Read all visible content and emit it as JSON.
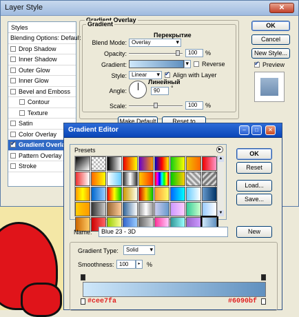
{
  "layer_style": {
    "title": "Layer Style",
    "styles_list": {
      "header": "Styles",
      "items": [
        {
          "label": "Blending Options: Default",
          "checkbox": false,
          "checked": false,
          "indent": false,
          "selected": false
        },
        {
          "label": "Drop Shadow",
          "checkbox": true,
          "checked": false,
          "indent": false,
          "selected": false
        },
        {
          "label": "Inner Shadow",
          "checkbox": true,
          "checked": false,
          "indent": false,
          "selected": false
        },
        {
          "label": "Outer Glow",
          "checkbox": true,
          "checked": false,
          "indent": false,
          "selected": false
        },
        {
          "label": "Inner Glow",
          "checkbox": true,
          "checked": false,
          "indent": false,
          "selected": false
        },
        {
          "label": "Bevel and Emboss",
          "checkbox": true,
          "checked": false,
          "indent": false,
          "selected": false
        },
        {
          "label": "Contour",
          "checkbox": true,
          "checked": false,
          "indent": true,
          "selected": false
        },
        {
          "label": "Texture",
          "checkbox": true,
          "checked": false,
          "indent": true,
          "selected": false
        },
        {
          "label": "Satin",
          "checkbox": true,
          "checked": false,
          "indent": false,
          "selected": false
        },
        {
          "label": "Color Overlay",
          "checkbox": true,
          "checked": false,
          "indent": false,
          "selected": false
        },
        {
          "label": "Gradient Overlay",
          "checkbox": true,
          "checked": true,
          "indent": false,
          "selected": true
        },
        {
          "label": "Pattern Overlay",
          "checkbox": true,
          "checked": false,
          "indent": false,
          "selected": false
        },
        {
          "label": "Stroke",
          "checkbox": true,
          "checked": false,
          "indent": false,
          "selected": false
        }
      ]
    },
    "section_title": "Gradient Overlay",
    "subsection_title": "Gradient",
    "blend_mode_label": "Blend Mode:",
    "blend_mode_value": "Overlay",
    "opacity_label": "Opacity:",
    "opacity_value": "100",
    "gradient_label": "Gradient:",
    "reverse_label": "Reverse",
    "style_label": "Style:",
    "style_value": "Linear",
    "align_label": "Align with Layer",
    "angle_label": "Angle:",
    "angle_value": "90",
    "angle_unit": "°",
    "scale_label": "Scale:",
    "scale_value": "100",
    "percent": "%",
    "make_default": "Make Default",
    "reset_default": "Reset to Default",
    "ok": "OK",
    "cancel": "Cancel",
    "new_style": "New Style...",
    "preview_label": "Preview",
    "annotation_blend": "Перекрытие",
    "annotation_style": "Линейный",
    "opacity_level": 0.95,
    "scale_level": 0.5
  },
  "gradient_editor": {
    "title": "Gradient Editor",
    "presets_label": "Presets",
    "ok": "OK",
    "reset": "Reset",
    "load": "Load...",
    "save": "Save...",
    "name_label": "Name:",
    "name_value": "Blue 23 - 3D",
    "new_button": "New",
    "gradient_type_label": "Gradient Type:",
    "gradient_type_value": "Solid",
    "smoothness_label": "Smoothness:",
    "smoothness_value": "100",
    "percent": "%",
    "start_color": "#cee7fa",
    "end_color": "#6090bf",
    "preset_swatches": [
      "linear-gradient(135deg,#000,#fff)",
      "repeating-conic-gradient(#bbb 0 25%,#fff 0 50%) 0 0/6px 6px",
      "linear-gradient(90deg,#000,rgba(0,0,0,0))",
      "linear-gradient(90deg,#e00,#ff0)",
      "linear-gradient(90deg,#60c,#f90)",
      "linear-gradient(90deg,#00c,#f00,#ff0)",
      "linear-gradient(90deg,#1c1,#ff0)",
      "linear-gradient(90deg,#f0c000,#f60)",
      "linear-gradient(90deg,#e00,#f9c)",
      "linear-gradient(90deg,#e33,#fff)",
      "linear-gradient(90deg,#f60,#ff0)",
      "linear-gradient(90deg,#fff,#6cf)",
      "linear-gradient(90deg,#333,#fff,#333)",
      "linear-gradient(90deg,#fc0,#f30)",
      "linear-gradient(90deg,#f00,#f0f,#00f,#0ff,#0f0,#ff0,#f00)",
      "linear-gradient(90deg,#0c0,#fc0)",
      "repeating-linear-gradient(45deg,#999 0 3px,#ddd 3px 6px)",
      "repeating-linear-gradient(-45deg,#7a7a7a 0 3px,#cfcfcf 3px 6px)",
      "linear-gradient(90deg,#f90,#ff0,#f90)",
      "linear-gradient(90deg,#06c,#9cf)",
      "linear-gradient(90deg,#f00,#ff0,#0c0)",
      "linear-gradient(90deg,#c90,#ffe)",
      "linear-gradient(90deg,#c00,#fc0,#0c0)",
      "linear-gradient(90deg,#f93,#ff6)",
      "linear-gradient(90deg,#06f,#0ff)",
      "linear-gradient(90deg,#6cf,#fff)",
      "linear-gradient(90deg,#69c,#036)",
      "linear-gradient(90deg,#ffcc00,#ff9900)",
      "linear-gradient(90deg,#333,#ccc)",
      "linear-gradient(90deg,#963,#fc9)",
      "linear-gradient(90deg,#369,#fff)",
      "linear-gradient(90deg,#999,#fff,#999)",
      "linear-gradient(90deg,#cce,#69c)",
      "linear-gradient(90deg,#c9f,#fcf)",
      "linear-gradient(90deg,#3c9,#cfc)",
      "linear-gradient(90deg,#9cf,#fff)",
      "linear-gradient(90deg,#c60,#fc6)",
      "linear-gradient(90deg,#c00,#f66)",
      "linear-gradient(90deg,#9c0,#ff9)",
      "linear-gradient(90deg,#3366cc,#99ccff)",
      "linear-gradient(90deg,#666,#ddd)",
      "linear-gradient(90deg,#f39,#fcf)",
      "linear-gradient(90deg,#399,#9ff)",
      "linear-gradient(90deg,#96c,#c9f)",
      "linear-gradient(90deg,#cee7fa,#6090bf)"
    ]
  }
}
